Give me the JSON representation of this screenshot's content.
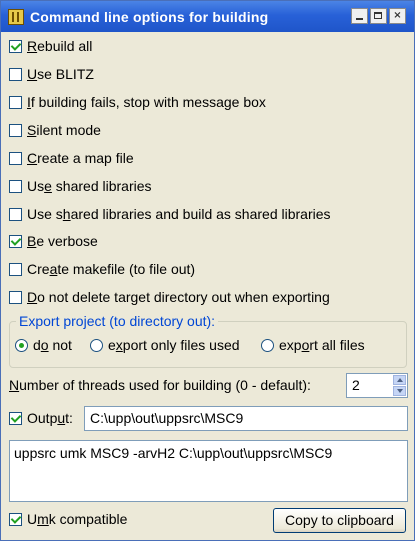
{
  "window": {
    "title": "Command line options for building",
    "controls": {
      "minimize": "_",
      "maximize": "□",
      "close": "×"
    }
  },
  "options": [
    {
      "pre": "",
      "key": "R",
      "post": "ebuild all",
      "checked": true
    },
    {
      "pre": "",
      "key": "U",
      "post": "se BLITZ",
      "checked": false
    },
    {
      "pre": "",
      "key": "I",
      "post": "f building fails, stop with message box",
      "checked": false
    },
    {
      "pre": "",
      "key": "S",
      "post": "ilent mode",
      "checked": false
    },
    {
      "pre": "",
      "key": "C",
      "post": "reate a map file",
      "checked": false
    },
    {
      "pre": "Us",
      "key": "e",
      "post": " shared libraries",
      "checked": false
    },
    {
      "pre": "Use s",
      "key": "h",
      "post": "ared libraries and build as shared libraries",
      "checked": false
    },
    {
      "pre": "",
      "key": "B",
      "post": "e verbose",
      "checked": true
    },
    {
      "pre": "Cre",
      "key": "a",
      "post": "te makefile (to file out)",
      "checked": false
    },
    {
      "pre": "",
      "key": "D",
      "post": "o not delete target directory out when exporting",
      "checked": false
    }
  ],
  "export": {
    "legend": "Export project (to directory out):",
    "options": [
      {
        "pre": "d",
        "key": "o",
        "post": " not",
        "selected": true
      },
      {
        "pre": "e",
        "key": "x",
        "post": "port only files used",
        "selected": false
      },
      {
        "pre": "exp",
        "key": "o",
        "post": "rt all files",
        "selected": false
      }
    ]
  },
  "threads": {
    "pre": "",
    "key": "N",
    "post": "umber of threads used for building (0 - default):",
    "value": "2"
  },
  "output": {
    "pre": "Outp",
    "key": "u",
    "post": "t:",
    "checked": true,
    "value": "C:\\upp\\out\\uppsrc\\MSC9"
  },
  "command_line": "uppsrc umk MSC9 -arvH2 C:\\upp\\out\\uppsrc\\MSC9",
  "umk": {
    "pre": "U",
    "key": "m",
    "post": "k compatible",
    "checked": true
  },
  "copy_button": "Copy to clipboard"
}
